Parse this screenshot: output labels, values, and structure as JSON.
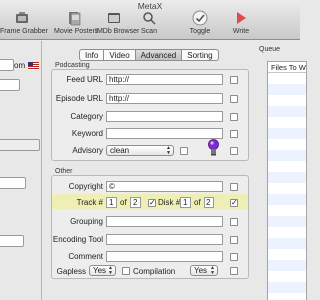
{
  "window": {
    "title": "MetaX"
  },
  "toolbar": [
    {
      "name": "frame-grabber",
      "label": "Frame Grabber"
    },
    {
      "name": "movie-posters",
      "label": "Movie Posters"
    },
    {
      "name": "imdb-browser",
      "label": "IMDb Browser"
    },
    {
      "name": "scan",
      "label": "Scan"
    },
    {
      "name": "toggle",
      "label": "Toggle"
    },
    {
      "name": "write",
      "label": "Write"
    }
  ],
  "left_panel": {
    "partial_text": "om"
  },
  "tabs": [
    {
      "label": "Info",
      "active": false
    },
    {
      "label": "Video",
      "active": false
    },
    {
      "label": "Advanced",
      "active": true
    },
    {
      "label": "Sorting",
      "active": false
    }
  ],
  "podcasting": {
    "title": "Podcasting",
    "feed_url": {
      "label": "Feed URL",
      "value": "http://"
    },
    "episode_url": {
      "label": "Episode URL",
      "value": "http://"
    },
    "category": {
      "label": "Category",
      "value": ""
    },
    "keyword": {
      "label": "Keyword",
      "value": ""
    },
    "advisory": {
      "label": "Advisory",
      "value": "clean"
    }
  },
  "other": {
    "title": "Other",
    "copyright": {
      "label": "Copyright",
      "value": "©"
    },
    "track": {
      "label": "Track #",
      "number": "1",
      "of_label": "of",
      "total": "2"
    },
    "disk": {
      "label": "Disk #",
      "number": "1",
      "of_label": "of",
      "total": "2"
    },
    "grouping": {
      "label": "Grouping",
      "value": ""
    },
    "encoding_tool": {
      "label": "Encoding Tool",
      "value": ""
    },
    "comment": {
      "label": "Comment",
      "value": ""
    },
    "gapless": {
      "label": "Gapless",
      "value": "Yes"
    },
    "compilation": {
      "label": "Compilation",
      "value": "Yes"
    }
  },
  "queue": {
    "title": "Queue",
    "header": "Files To W"
  },
  "colors": {
    "highlight": "#efefb5",
    "accent": "#5b8fd6"
  }
}
